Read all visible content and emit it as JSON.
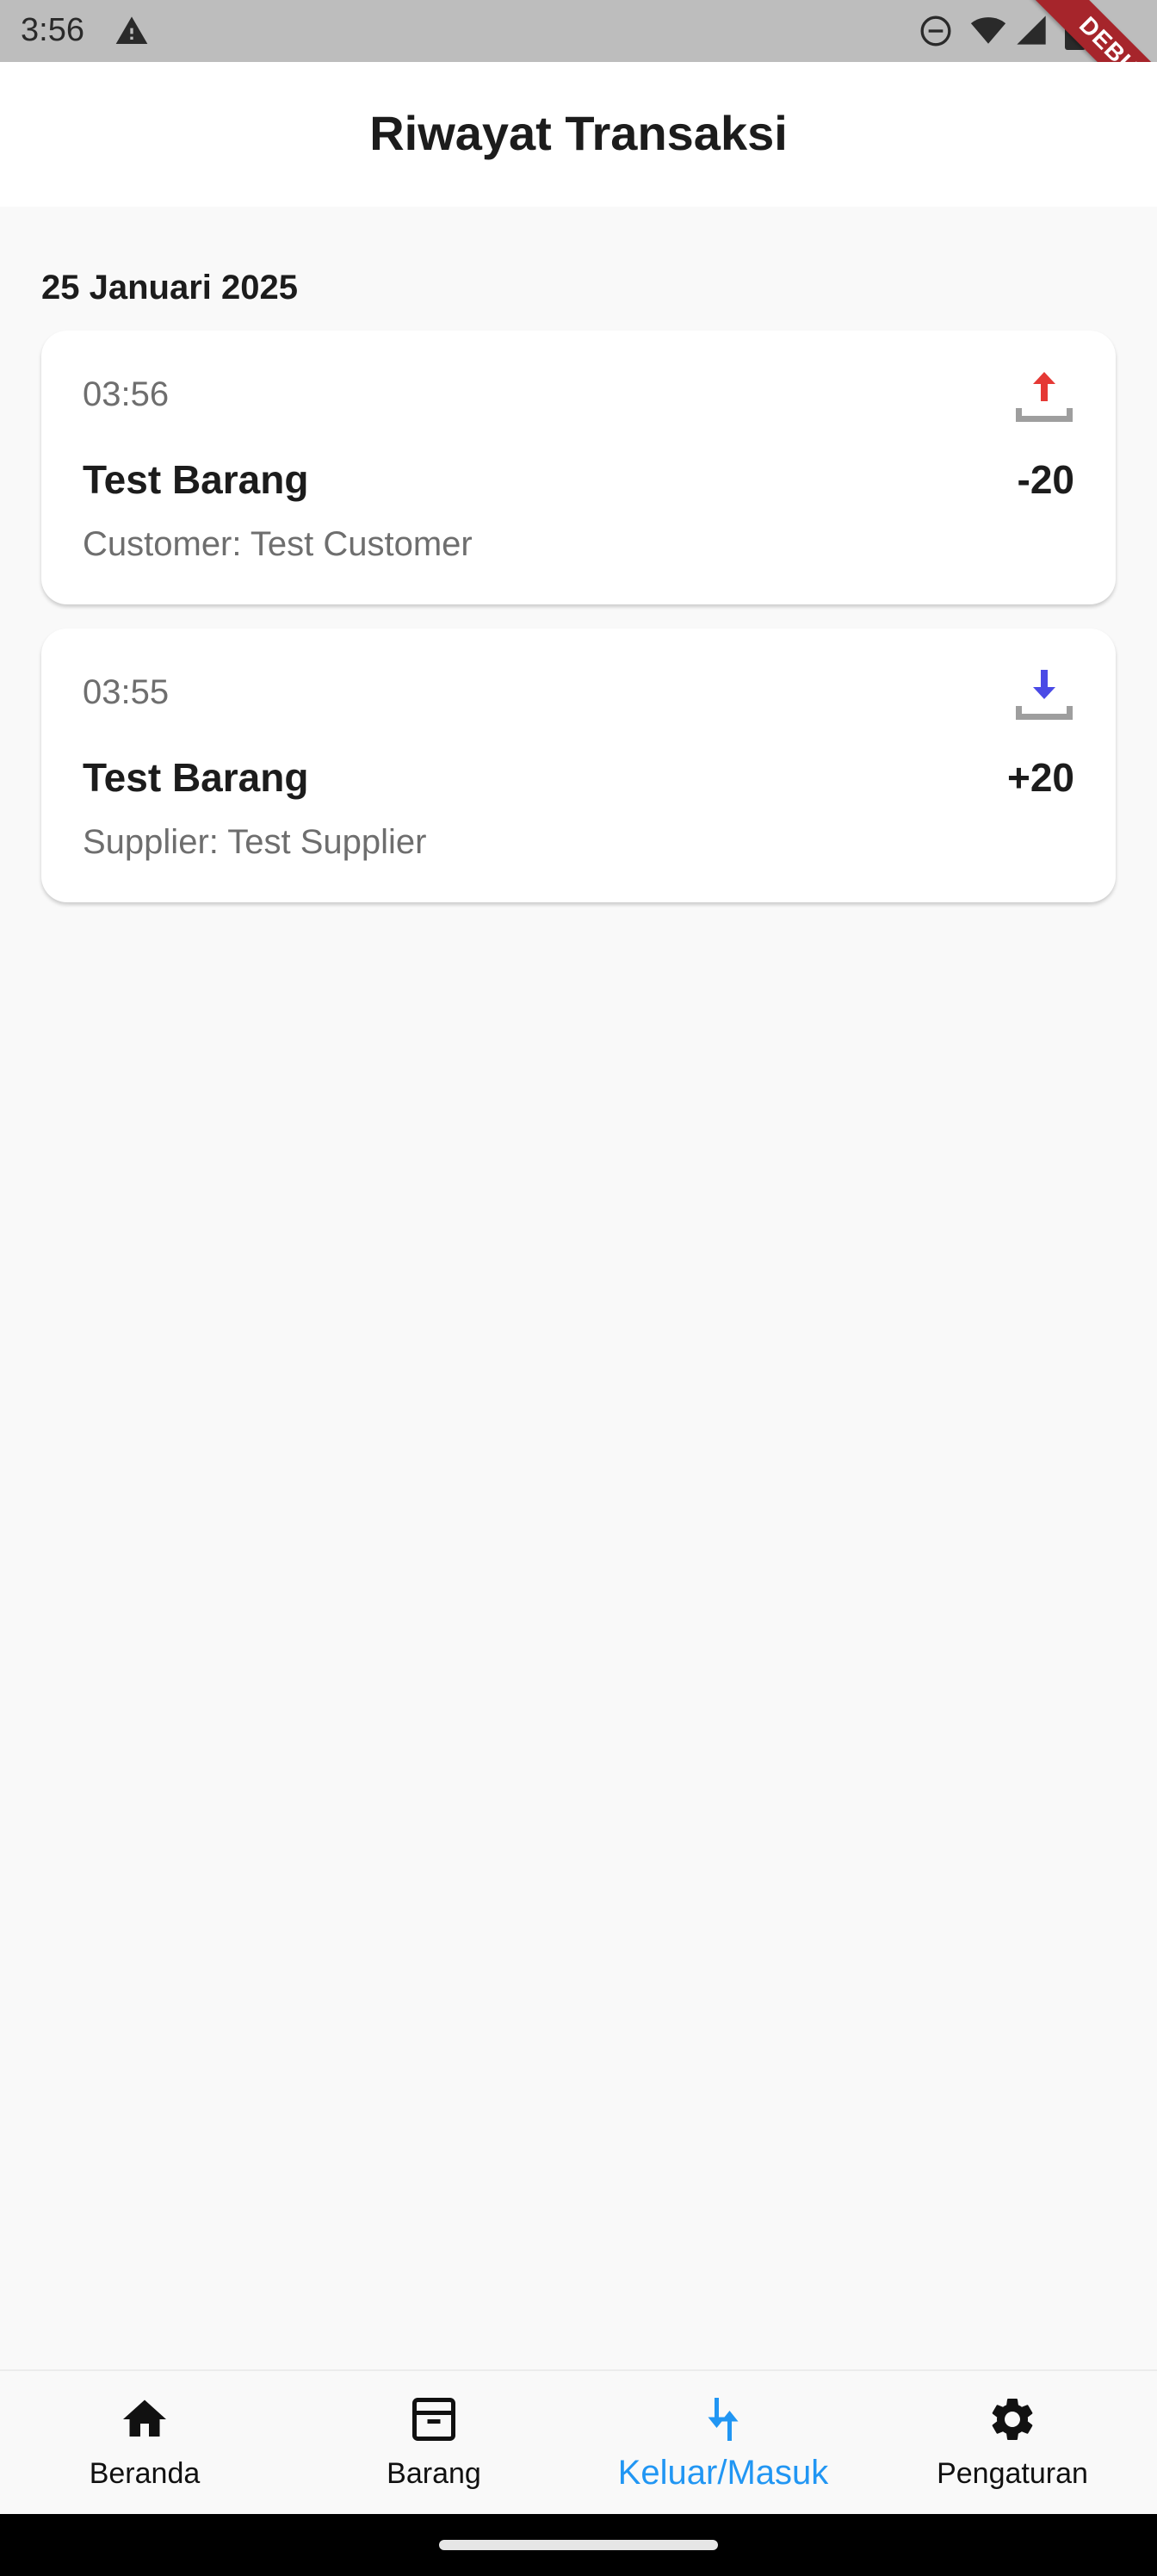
{
  "status_bar": {
    "time": "3:56",
    "icons": [
      "warning-icon",
      "do-not-disturb-icon",
      "wifi-icon",
      "signal-icon",
      "battery-icon"
    ],
    "debug_label": "DEBUG"
  },
  "app_bar": {
    "title": "Riwayat Transaksi"
  },
  "date_group": "25 Januari 2025",
  "transactions": [
    {
      "time": "03:56",
      "item": "Test Barang",
      "amount": "-20",
      "party": "Customer: Test Customer",
      "type": "out",
      "icon": "upload-icon",
      "icon_color": "#e53935"
    },
    {
      "time": "03:55",
      "item": "Test Barang",
      "amount": "+20",
      "party": "Supplier: Test Supplier",
      "type": "in",
      "icon": "download-icon",
      "icon_color": "#4a4ae6"
    }
  ],
  "bottom_nav": {
    "items": [
      {
        "label": "Beranda",
        "icon": "home-icon",
        "active": false
      },
      {
        "label": "Barang",
        "icon": "archive-box-icon",
        "active": false
      },
      {
        "label": "Keluar/Masuk",
        "icon": "swap-vert-icon",
        "active": true
      },
      {
        "label": "Pengaturan",
        "icon": "gear-icon",
        "active": false
      }
    ],
    "active_color": "#2196f3"
  }
}
